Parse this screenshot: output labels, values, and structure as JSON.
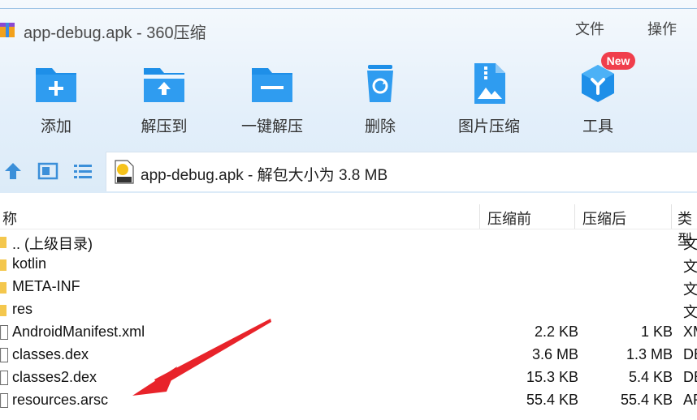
{
  "window": {
    "title": "app-debug.apk - 360压缩",
    "menu": [
      "文件",
      "操作"
    ]
  },
  "toolbar": {
    "items": [
      {
        "label": "添加",
        "icon": "add-folder-icon"
      },
      {
        "label": "解压到",
        "icon": "extract-to-folder-icon"
      },
      {
        "label": "一键解压",
        "icon": "one-click-extract-icon"
      },
      {
        "label": "删除",
        "icon": "recycle-bin-icon"
      },
      {
        "label": "图片压缩",
        "icon": "image-compress-icon"
      },
      {
        "label": "工具",
        "icon": "tools-cube-icon"
      }
    ],
    "new_badge": "New",
    "accent": "#1e8fe8"
  },
  "pathbar": {
    "text": "app-debug.apk - 解包大小为 3.8 MB"
  },
  "list": {
    "columns": [
      "称",
      "压缩前",
      "压缩后",
      "类型"
    ],
    "rows": [
      {
        "name": ".. (上级目录)",
        "kind": "folder",
        "size": "",
        "packed": "",
        "type": "文"
      },
      {
        "name": "kotlin",
        "kind": "folder",
        "size": "",
        "packed": "",
        "type": "文"
      },
      {
        "name": "META-INF",
        "kind": "folder",
        "size": "",
        "packed": "",
        "type": "文"
      },
      {
        "name": "res",
        "kind": "folder",
        "size": "",
        "packed": "",
        "type": "文"
      },
      {
        "name": "AndroidManifest.xml",
        "kind": "file",
        "size": "2.2 KB",
        "packed": "1 KB",
        "type": "XM"
      },
      {
        "name": "classes.dex",
        "kind": "file",
        "size": "3.6 MB",
        "packed": "1.3 MB",
        "type": "DE"
      },
      {
        "name": "classes2.dex",
        "kind": "file",
        "size": "15.3 KB",
        "packed": "5.4 KB",
        "type": "DE"
      },
      {
        "name": "resources.arsc",
        "kind": "file",
        "size": "55.4 KB",
        "packed": "55.4 KB",
        "type": "AR"
      }
    ]
  },
  "annotation": {
    "arrow_color": "#e8232a"
  }
}
